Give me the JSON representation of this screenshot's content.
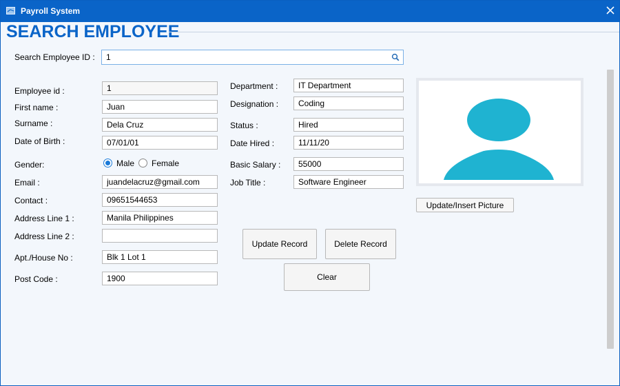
{
  "window": {
    "title": "Payroll System"
  },
  "heading": "SEARCH EMPLOYEE",
  "search": {
    "label": "Search Employee ID :",
    "value": "1"
  },
  "left": {
    "employee_id": {
      "label": "Employee id :",
      "value": "1"
    },
    "first_name": {
      "label": "First name :",
      "value": "Juan"
    },
    "surname": {
      "label": "Surname :",
      "value": "Dela Cruz"
    },
    "dob": {
      "label": "Date of Birth :",
      "value": "07/01/01"
    },
    "gender": {
      "label": "Gender:",
      "male": "Male",
      "female": "Female",
      "selected": "Male"
    },
    "email": {
      "label": "Email :",
      "value": "juandelacruz@gmail.com"
    },
    "contact": {
      "label": "Contact :",
      "value": "09651544653"
    },
    "address1": {
      "label": "Address Line 1 :",
      "value": "Manila Philippines"
    },
    "address2": {
      "label": "Address Line 2 :",
      "value": ""
    },
    "apt": {
      "label": "Apt./House No :",
      "value": "Blk 1 Lot 1"
    },
    "postcode": {
      "label": "Post Code :",
      "value": "1900"
    }
  },
  "right": {
    "department": {
      "label": "Department :",
      "value": "IT Department"
    },
    "designation": {
      "label": "Designation :",
      "value": "Coding"
    },
    "status": {
      "label": "Status :",
      "value": "Hired"
    },
    "date_hired": {
      "label": "Date Hired :",
      "value": "11/11/20"
    },
    "salary": {
      "label": "Basic Salary :",
      "value": "55000"
    },
    "job_title": {
      "label": "Job Title :",
      "value": "Software Engineer"
    }
  },
  "buttons": {
    "update_picture": "Update/Insert Picture",
    "update_record": "Update Record",
    "delete_record": "Delete Record",
    "clear": "Clear"
  },
  "colors": {
    "titlebar": "#0a64c8",
    "heading": "#0a64c8",
    "avatar": "#1fb3d1",
    "background": "#f3f7fc"
  },
  "icons": {
    "app": "app-window-icon",
    "close": "close-icon",
    "search": "search-icon",
    "photo": "user-avatar-icon"
  }
}
